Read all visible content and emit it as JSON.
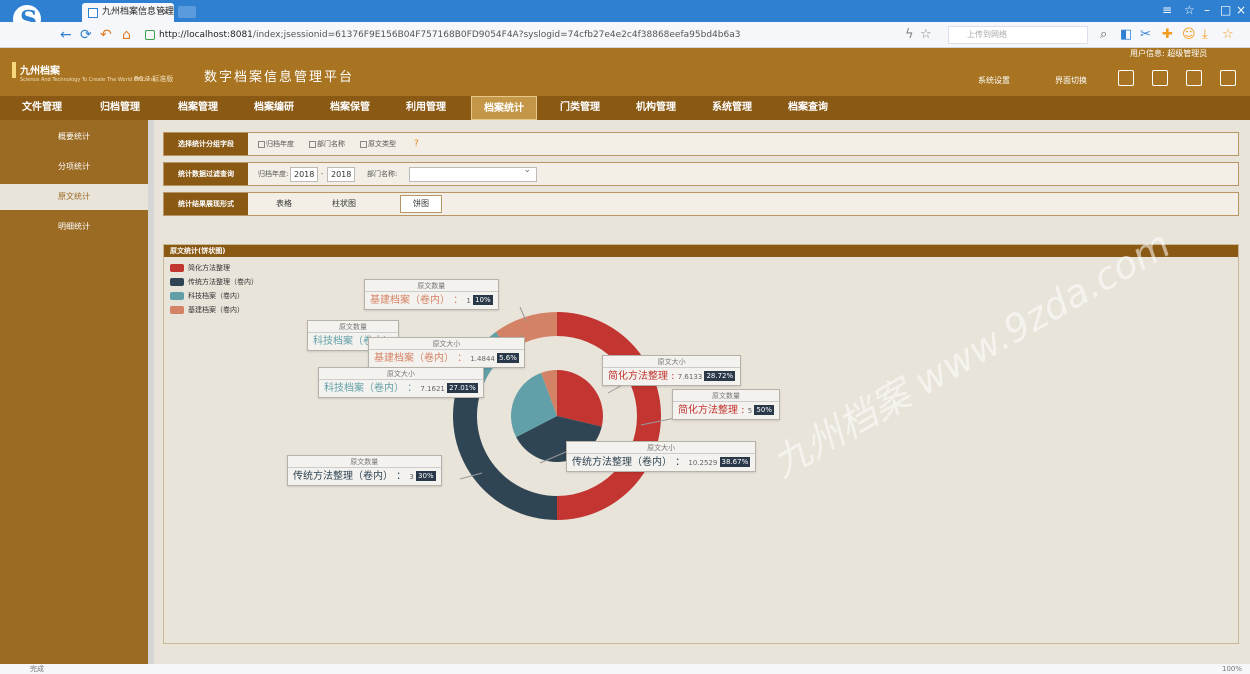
{
  "browser": {
    "tab_title": "九州档案信息管理平台",
    "tab_close": "×",
    "url_host": "http://localhost:8081",
    "url_rest": "/index;jsessionid=61376F9E156B04F757168B0FD9054F4A?syslogid=74cfb27e4e2c4f38868eefa95bd4b6a3",
    "search_placeholder": "上传到网络",
    "window_controls": [
      "≡",
      "☆",
      "–",
      "□",
      "×"
    ],
    "status_left": "完成",
    "status_right": "100%"
  },
  "app": {
    "brand": "九州档案",
    "brand_sub": "Science And Technology To Create The World Of China",
    "version": "R6.7 标准版",
    "system_name": "数字档案信息管理平台",
    "user_info": "用户信息: 超级管理员",
    "links": [
      "系统设置",
      "界面切换"
    ]
  },
  "menu": [
    {
      "label": "文件管理"
    },
    {
      "label": "归档管理"
    },
    {
      "label": "档案管理"
    },
    {
      "label": "档案编研"
    },
    {
      "label": "档案保管"
    },
    {
      "label": "利用管理"
    },
    {
      "label": "档案统计",
      "active": true
    },
    {
      "label": "门类管理"
    },
    {
      "label": "机构管理"
    },
    {
      "label": "系统管理"
    },
    {
      "label": "档案查询"
    }
  ],
  "sidebar": [
    {
      "label": "概要统计"
    },
    {
      "label": "分项统计"
    },
    {
      "label": "原文统计",
      "active": true
    },
    {
      "label": "明细统计"
    }
  ],
  "filters": {
    "group_label": "选择统计分组字段",
    "group_options": [
      "归档年度",
      "部门名称",
      "原文类型"
    ],
    "help": "?",
    "query_label": "统计数据过滤查询",
    "year_label": "归档年度:",
    "year_from": "2018",
    "year_sep": "-",
    "year_to": "2018",
    "dept_label": "部门名称:",
    "view_label": "统计结果展现形式",
    "view_options": [
      {
        "label": "表格"
      },
      {
        "label": "柱状图"
      },
      {
        "label": "饼图",
        "active": true
      }
    ]
  },
  "chart_panel": {
    "title": "原文统计(饼状图)"
  },
  "chart_data": {
    "type": "pie",
    "variant": "nested-donut",
    "legend_placement": "top-left",
    "legend": [
      {
        "name": "简化方法整理",
        "color": "#c23531"
      },
      {
        "name": "传统方法整理（卷内）",
        "color": "#2f4554"
      },
      {
        "name": "科技档案（卷内）",
        "color": "#61a0a8"
      },
      {
        "name": "基建档案（卷内）",
        "color": "#d48265"
      }
    ],
    "inner": {
      "metric": "原文大小",
      "slices": [
        {
          "name": "简化方法整理",
          "value": 7.6133,
          "percent": "28.72%",
          "color": "#c23531"
        },
        {
          "name": "传统方法整理（卷内）",
          "value": 10.2529,
          "percent": "38.67%",
          "color": "#2f4554"
        },
        {
          "name": "科技档案（卷内）",
          "value": 7.1621,
          "percent": "27.01%",
          "color": "#61a0a8"
        },
        {
          "name": "基建档案（卷内）",
          "value": 1.4844,
          "percent": "5.6%",
          "color": "#d48265"
        }
      ]
    },
    "outer": {
      "metric": "原文数量",
      "slices": [
        {
          "name": "简化方法整理",
          "value": 5,
          "percent": "50%",
          "color": "#c23531"
        },
        {
          "name": "传统方法整理（卷内）",
          "value": 3,
          "percent": "30%",
          "color": "#2f4554"
        },
        {
          "name": "科技档案（卷内）",
          "value": 1,
          "percent": "10%",
          "color": "#61a0a8"
        },
        {
          "name": "基建档案（卷内）",
          "value": 1,
          "percent": "10%",
          "color": "#d48265"
        }
      ]
    },
    "tooltips": [
      {
        "head": "原文数量",
        "name": "基建档案（卷内）",
        "sep": "：",
        "value": "1",
        "pct": "10%",
        "color": "#d48265"
      },
      {
        "head": "原文数量",
        "name": "科技档案（卷内）",
        "sep": "",
        "value": "",
        "pct": "",
        "color": "#61a0a8"
      },
      {
        "head": "原文大小",
        "name": "基建档案（卷内）",
        "sep": "：",
        "value": "1.4844",
        "pct": "5.6%",
        "color": "#d48265"
      },
      {
        "head": "原文大小",
        "name": "科技档案（卷内）",
        "sep": "：",
        "value": "7.1621",
        "pct": "27.01%",
        "color": "#61a0a8"
      },
      {
        "head": "原文大小",
        "name": "简化方法整理",
        "sep": ":",
        "value": "7.6133",
        "pct": "28.72%",
        "color": "#c23531"
      },
      {
        "head": "原文数量",
        "name": "简化方法整理",
        "sep": ":",
        "value": "5",
        "pct": "50%",
        "color": "#c23531"
      },
      {
        "head": "原文大小",
        "name": "传统方法整理（卷内）",
        "sep": "：",
        "value": "10.2529",
        "pct": "38.67%",
        "color": "#2f4554"
      },
      {
        "head": "原文数量",
        "name": "传统方法整理（卷内）",
        "sep": "：",
        "value": "3",
        "pct": "30%",
        "color": "#2f4554"
      }
    ]
  },
  "watermark": "九州档案 www.9zda.com"
}
